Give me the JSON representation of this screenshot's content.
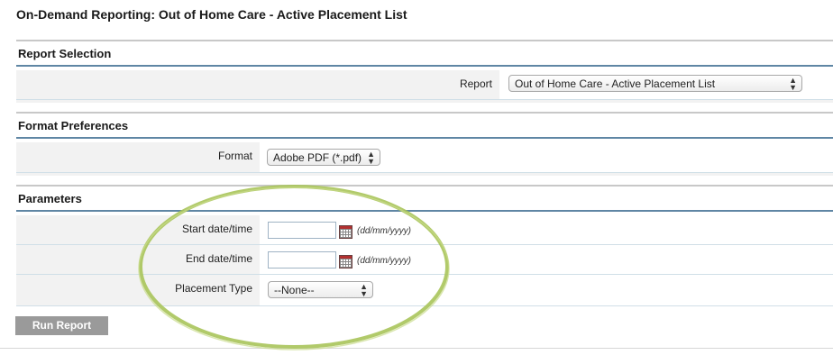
{
  "page": {
    "title": "On-Demand Reporting: Out of Home Care - Active Placement List"
  },
  "report_selection": {
    "header": "Report Selection",
    "report_label": "Report",
    "report_value": "Out of Home Care - Active Placement List"
  },
  "format_preferences": {
    "header": "Format Preferences",
    "format_label": "Format",
    "format_value": "Adobe PDF (*.pdf)"
  },
  "parameters": {
    "header": "Parameters",
    "start_label": "Start date/time",
    "start_value": "",
    "start_hint": "(dd/mm/yyyy)",
    "end_label": "End date/time",
    "end_value": "",
    "end_hint": "(dd/mm/yyyy)",
    "placement_label": "Placement Type",
    "placement_value": "--None--"
  },
  "actions": {
    "run_label": "Run Report"
  },
  "colors": {
    "highlight": "#a8c45a",
    "header_rule": "#5f86a4",
    "button": "#9a9a9a"
  },
  "icons": {
    "calendar": "calendar-icon",
    "select_arrows": "up-down-arrows-icon"
  }
}
